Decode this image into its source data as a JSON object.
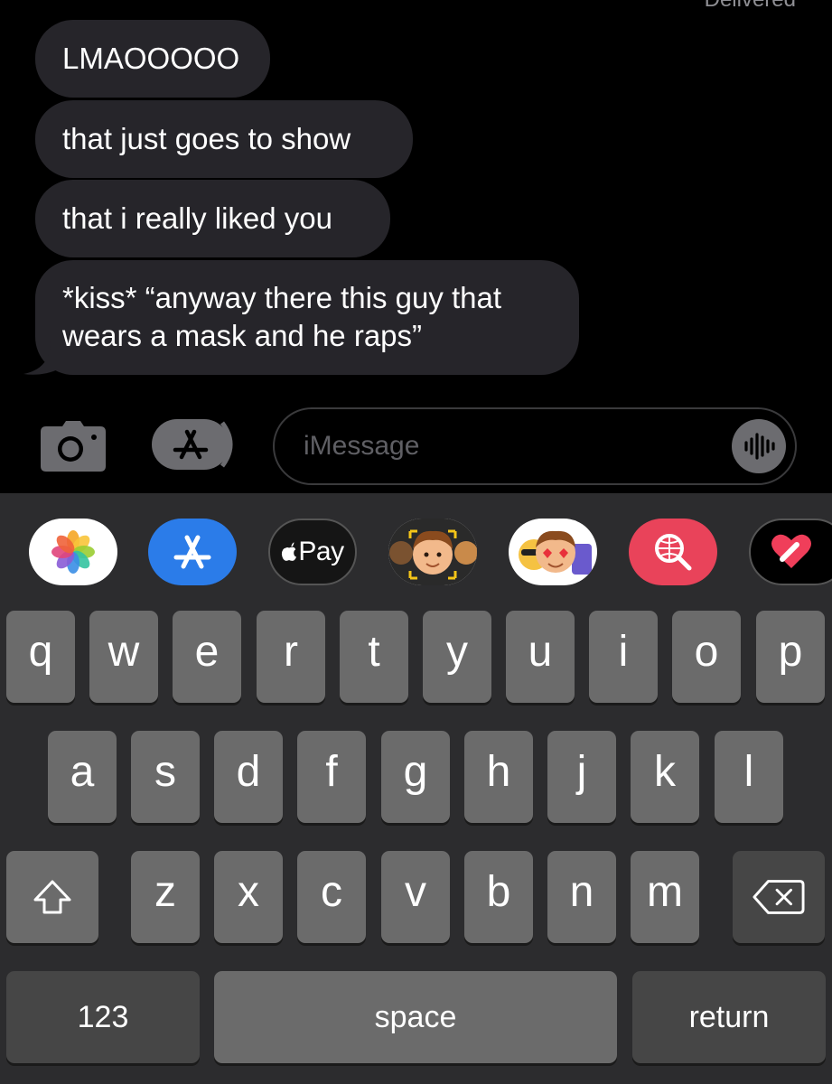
{
  "conversation": {
    "status": "Delivered",
    "messages": [
      {
        "text": "LMAOOOOO"
      },
      {
        "text": "that just goes to show"
      },
      {
        "text": "that i really liked you"
      },
      {
        "text": "*kiss* “anyway there this guy that\nwears a mask and he raps”"
      }
    ]
  },
  "input_bar": {
    "placeholder": "iMessage"
  },
  "app_drawer": {
    "apps": [
      {
        "name": "photos-app"
      },
      {
        "name": "app-store-app"
      },
      {
        "name": "apple-pay-app",
        "label": "Pay"
      },
      {
        "name": "memoji-app"
      },
      {
        "name": "memoji-stickers-app"
      },
      {
        "name": "image-search-app"
      },
      {
        "name": "digital-touch-app"
      }
    ]
  },
  "keyboard": {
    "row1": [
      "q",
      "w",
      "e",
      "r",
      "t",
      "y",
      "u",
      "i",
      "o",
      "p"
    ],
    "row2": [
      "a",
      "s",
      "d",
      "f",
      "g",
      "h",
      "j",
      "k",
      "l"
    ],
    "row3": [
      "z",
      "x",
      "c",
      "v",
      "b",
      "n",
      "m"
    ],
    "numbers_label": "123",
    "space_label": "space",
    "return_label": "return"
  },
  "colors": {
    "background": "#000000",
    "bubble_received": "#26252a",
    "keyboard_bg": "#2c2c2e",
    "key": "#6b6b6b",
    "key_dark": "#464646",
    "app_store_blue": "#2b7ce9",
    "search_pink": "#e9435a"
  }
}
